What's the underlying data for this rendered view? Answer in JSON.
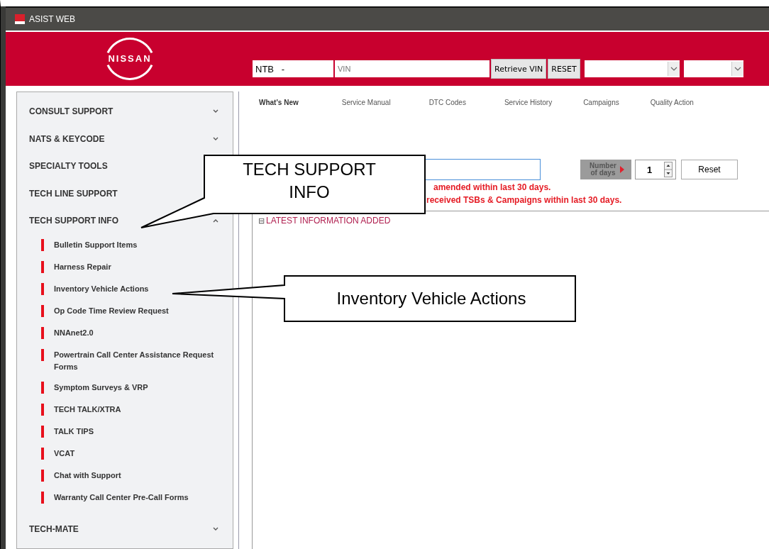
{
  "window": {
    "title": "ASIST WEB"
  },
  "header": {
    "logo": "NISSAN",
    "dealer_field": {
      "value": "NTB   -"
    },
    "vin_field": {
      "placeholder": "VIN"
    },
    "buttons": [
      "Retrieve VIN",
      "RESET"
    ]
  },
  "sidebar": {
    "sections": [
      {
        "label": "CONSULT SUPPORT",
        "expanded": false
      },
      {
        "label": "NATS & KEYCODE",
        "expanded": false
      },
      {
        "label": "SPECIALTY TOOLS"
      },
      {
        "label": "TECH LINE SUPPORT"
      },
      {
        "label": "TECH SUPPORT INFO",
        "expanded": true,
        "children": [
          {
            "label": "Bulletin Support Items"
          },
          {
            "label": "Harness Repair"
          },
          {
            "label": "Inventory Vehicle Actions"
          },
          {
            "label": "Op Code Time Review Request"
          },
          {
            "label": "NNAnet2.0"
          },
          {
            "label": "Powertrain Call Center Assistance Request Forms"
          },
          {
            "label": "Symptom Surveys & VRP"
          },
          {
            "label": "TECH TALK/XTRA"
          },
          {
            "label": "TALK TIPS"
          },
          {
            "label": "VCAT"
          },
          {
            "label": "Chat with Support"
          },
          {
            "label": "Warranty Call Center Pre-Call Forms"
          }
        ]
      },
      {
        "label": "TECH-MATE",
        "expanded": false
      }
    ]
  },
  "tabs": [
    {
      "label": "What's New",
      "selected": true
    },
    {
      "label": "Service Manual",
      "selected": false
    },
    {
      "label": "DTC Codes",
      "selected": false
    },
    {
      "label": "Service History",
      "selected": false
    },
    {
      "label": "Campaigns",
      "selected": false
    },
    {
      "label": "Quality Action",
      "selected": false
    }
  ],
  "filter": {
    "days_label": "Number of days",
    "days_value": "1",
    "reset": "Reset",
    "notes": [
      "amended within last 30 days.",
      "received TSBs & Campaigns within last 30 days."
    ]
  },
  "panel": {
    "toggle": "⊟",
    "title": "LATEST INFORMATION ADDED"
  },
  "callouts": [
    {
      "text": "TECH SUPPORT INFO"
    },
    {
      "text": "Inventory Vehicle Actions"
    }
  ]
}
